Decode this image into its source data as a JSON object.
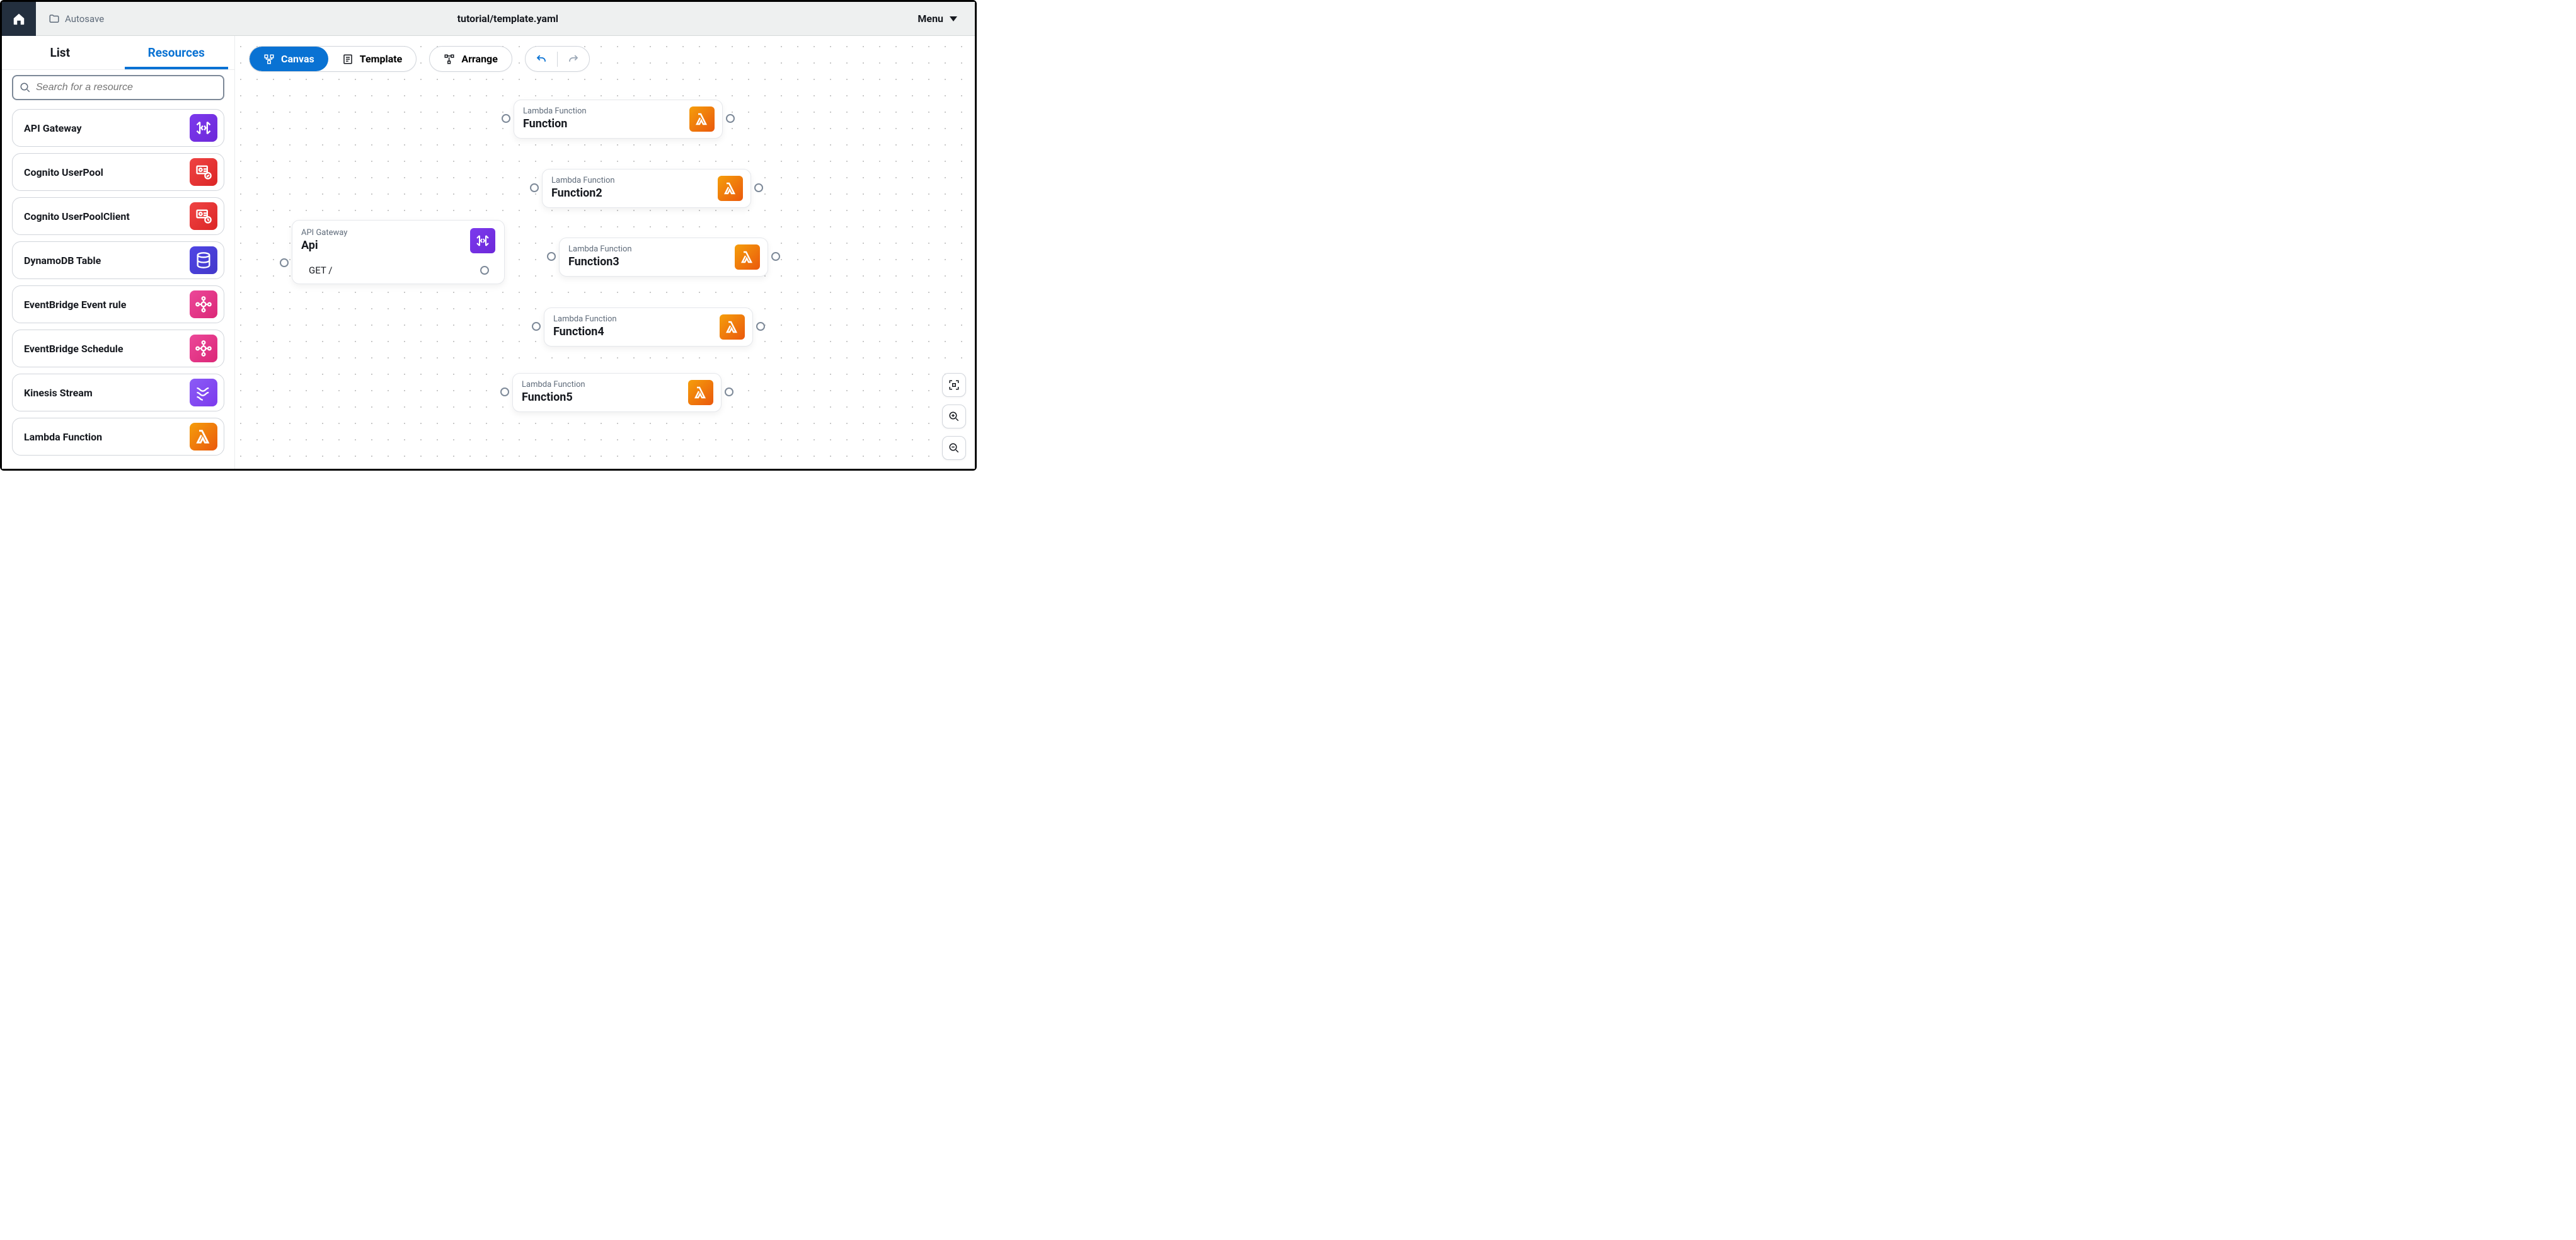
{
  "topbar": {
    "autosave_label": "Autosave",
    "filepath": "tutorial/template.yaml",
    "menu_label": "Menu"
  },
  "tabs": {
    "list": "List",
    "resources": "Resources"
  },
  "search": {
    "placeholder": "Search for a resource"
  },
  "resources": [
    {
      "label": "API Gateway",
      "icon": "api-gateway-icon",
      "color": "bg-purple"
    },
    {
      "label": "Cognito UserPool",
      "icon": "cognito-icon",
      "color": "bg-red"
    },
    {
      "label": "Cognito UserPoolClient",
      "icon": "cognito-client-icon",
      "color": "bg-red"
    },
    {
      "label": "DynamoDB Table",
      "icon": "dynamodb-icon",
      "color": "bg-blue"
    },
    {
      "label": "EventBridge Event rule",
      "icon": "eventbridge-icon",
      "color": "bg-pink"
    },
    {
      "label": "EventBridge Schedule",
      "icon": "eventbridge-schedule-icon",
      "color": "bg-pink"
    },
    {
      "label": "Kinesis Stream",
      "icon": "kinesis-icon",
      "color": "bg-violet"
    },
    {
      "label": "Lambda Function",
      "icon": "lambda-icon",
      "color": "bg-orange"
    }
  ],
  "toolbar": {
    "canvas": "Canvas",
    "template": "Template",
    "arrange": "Arrange"
  },
  "canvas": {
    "api": {
      "type": "API Gateway",
      "name": "Api",
      "endpoint": "GET /"
    },
    "lambdas": [
      {
        "type": "Lambda Function",
        "name": "Function"
      },
      {
        "type": "Lambda Function",
        "name": "Function2"
      },
      {
        "type": "Lambda Function",
        "name": "Function3"
      },
      {
        "type": "Lambda Function",
        "name": "Function4"
      },
      {
        "type": "Lambda Function",
        "name": "Function5"
      }
    ]
  }
}
